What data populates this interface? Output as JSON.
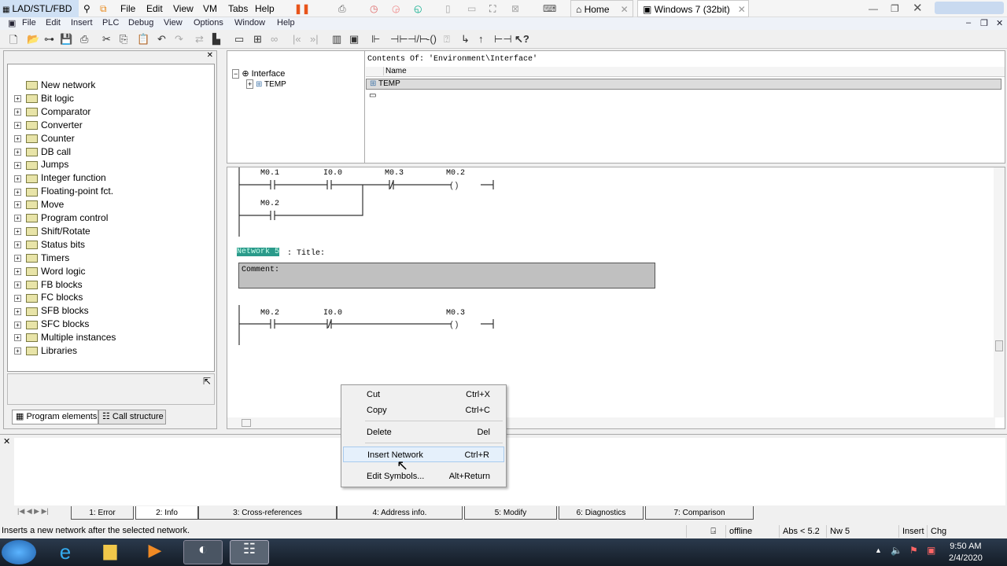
{
  "vm": {
    "active_tab": "LAD/STL/FBD",
    "menu": [
      "File",
      "Edit",
      "View",
      "VM",
      "Tabs",
      "Help"
    ],
    "home_tab": "Home",
    "vm_tab": "Windows 7 (32bit)"
  },
  "app_menu": [
    "File",
    "Edit",
    "Insert",
    "PLC",
    "Debug",
    "View",
    "Options",
    "Window",
    "Help"
  ],
  "sidebar": {
    "items": [
      "New network",
      "Bit logic",
      "Comparator",
      "Converter",
      "Counter",
      "DB call",
      "Jumps",
      "Integer function",
      "Floating-point fct.",
      "Move",
      "Program control",
      "Shift/Rotate",
      "Status bits",
      "Timers",
      "Word logic",
      "FB blocks",
      "FC blocks",
      "SFB blocks",
      "SFC blocks",
      "Multiple instances",
      "Libraries"
    ],
    "tabs": [
      "Program elements",
      "Call structure"
    ]
  },
  "interface": {
    "tree_root": "Interface",
    "tree_child": "TEMP",
    "contents_title": "Contents Of: 'Environment\\Interface'",
    "column": "Name",
    "row": "TEMP"
  },
  "editor": {
    "net4": {
      "c1": "M0.1",
      "c2": "I0.0",
      "c3": "M0.3",
      "coil": "M0.2",
      "branch": "M0.2"
    },
    "net5": {
      "label": "Network 5",
      "title": ": Title:",
      "comment": "Comment:",
      "c1": "M0.2",
      "c2": "I0.0",
      "coil": "M0.3"
    }
  },
  "context_menu": [
    {
      "label": "Cut",
      "shortcut": "Ctrl+X"
    },
    {
      "label": "Copy",
      "shortcut": "Ctrl+C"
    },
    {
      "label": "Delete",
      "shortcut": "Del"
    },
    {
      "label": "Insert Network",
      "shortcut": "Ctrl+R"
    },
    {
      "label": "Edit Symbols...",
      "shortcut": "Alt+Return"
    }
  ],
  "output_tabs": [
    "1: Error",
    "2: Info",
    "3: Cross-references",
    "4: Address info.",
    "5: Modify",
    "6: Diagnostics",
    "7: Comparison"
  ],
  "status": {
    "hint": "Inserts a new network after the selected network.",
    "mode": "offline",
    "abs": "Abs < 5.2",
    "nw": "Nw 5",
    "insert": "Insert",
    "chg": "Chg"
  },
  "clock": {
    "time": "9:50 AM",
    "date": "2/4/2020"
  }
}
